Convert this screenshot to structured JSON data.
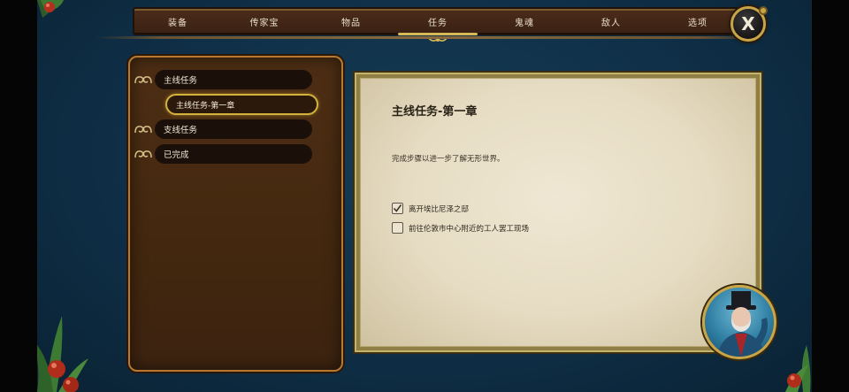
{
  "nav": {
    "tabs": [
      {
        "label": "装备",
        "active": false
      },
      {
        "label": "传家宝",
        "active": false
      },
      {
        "label": "物品",
        "active": false
      },
      {
        "label": "任务",
        "active": true
      },
      {
        "label": "鬼魂",
        "active": false
      },
      {
        "label": "敌人",
        "active": false
      },
      {
        "label": "选项",
        "active": false
      }
    ],
    "close_label": "X"
  },
  "quest_list": {
    "categories": [
      {
        "label": "主线任务"
      },
      {
        "label": "支线任务"
      },
      {
        "label": "已完成"
      }
    ],
    "selected_quest": "主线任务-第一章"
  },
  "quest_detail": {
    "title": "主线任务-第一章",
    "description": "完成步骤以进一步了解无形世界。",
    "objectives": [
      {
        "label": "离开埃比尼泽之邸",
        "completed": true
      },
      {
        "label": "前往伦敦市中心附近的工人罢工现场",
        "completed": false
      }
    ]
  },
  "colors": {
    "background": "#0f2f47",
    "nav_bar": "#4b2c1a",
    "gold_accent": "#d3b23c",
    "list_panel": "#4d2e14",
    "paper": "#e6dcc3"
  },
  "icons": {
    "close": "close-icon",
    "category": "scroll-ornament-icon",
    "checked": "checkmark-icon",
    "character": "character-portrait"
  }
}
